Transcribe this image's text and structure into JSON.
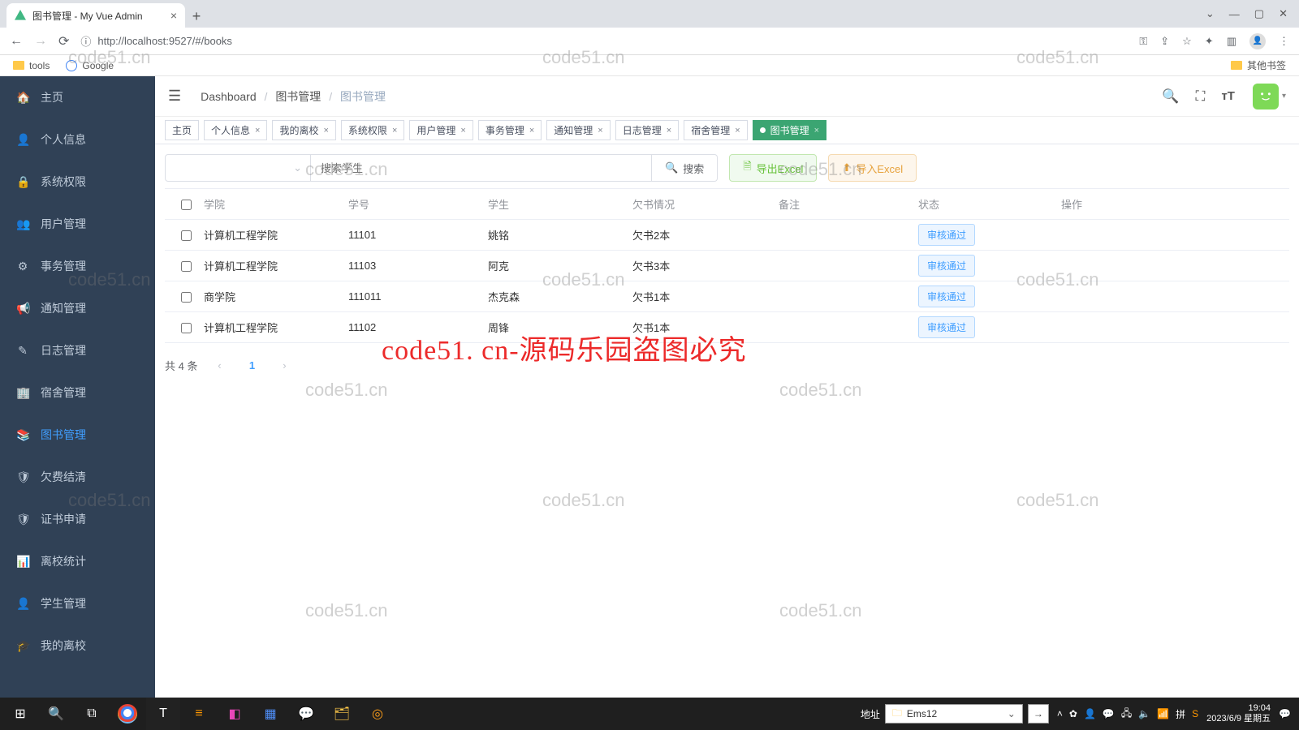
{
  "browser": {
    "tab_title": "图书管理 - My Vue Admin",
    "url": "http://localhost:9527/#/books",
    "bookmarks": {
      "tools": "tools",
      "google": "Google",
      "other": "其他书签"
    }
  },
  "sidebar": {
    "items": [
      {
        "label": "主页"
      },
      {
        "label": "个人信息"
      },
      {
        "label": "系统权限"
      },
      {
        "label": "用户管理"
      },
      {
        "label": "事务管理"
      },
      {
        "label": "通知管理"
      },
      {
        "label": "日志管理"
      },
      {
        "label": "宿舍管理"
      },
      {
        "label": "图书管理"
      },
      {
        "label": "欠费结清"
      },
      {
        "label": "证书申请"
      },
      {
        "label": "离校统计"
      },
      {
        "label": "学生管理"
      },
      {
        "label": "我的离校"
      }
    ],
    "active_index": 8
  },
  "breadcrumb": {
    "a": "Dashboard",
    "b": "图书管理",
    "c": "图书管理"
  },
  "topbar_icons": {
    "search": "search",
    "fullscreen": "fullscreen",
    "textsize": "textsize"
  },
  "tags": [
    {
      "label": "主页",
      "closable": false
    },
    {
      "label": "个人信息",
      "closable": true
    },
    {
      "label": "我的离校",
      "closable": true
    },
    {
      "label": "系统权限",
      "closable": true
    },
    {
      "label": "用户管理",
      "closable": true
    },
    {
      "label": "事务管理",
      "closable": true
    },
    {
      "label": "通知管理",
      "closable": true
    },
    {
      "label": "日志管理",
      "closable": true
    },
    {
      "label": "宿舍管理",
      "closable": true
    },
    {
      "label": "图书管理",
      "closable": true,
      "active": true
    }
  ],
  "toolbar": {
    "select_placeholder": "",
    "search_placeholder": "搜索学生",
    "search_btn": "搜索",
    "export_btn": "导出Excel",
    "import_btn": "导入Excel"
  },
  "table": {
    "headers": {
      "college": "学院",
      "sid": "学号",
      "student": "学生",
      "owe": "欠书情况",
      "note": "备注",
      "status": "状态",
      "op": "操作"
    },
    "rows": [
      {
        "college": "计算机工程学院",
        "sid": "11101",
        "student": "姚铭",
        "owe": "欠书2本",
        "note": "",
        "status_btn": "审核通过"
      },
      {
        "college": "计算机工程学院",
        "sid": "11103",
        "student": "阿克",
        "owe": "欠书3本",
        "note": "",
        "status_btn": "审核通过"
      },
      {
        "college": "商学院",
        "sid": "111011",
        "student": "杰克森",
        "owe": "欠书1本",
        "note": "",
        "status_btn": "审核通过"
      },
      {
        "college": "计算机工程学院",
        "sid": "11102",
        "student": "周锋",
        "owe": "欠书1本",
        "note": "",
        "status_btn": "审核通过"
      }
    ]
  },
  "pagination": {
    "total_text": "共 4 条",
    "current": "1"
  },
  "watermarks": {
    "small": "code51.cn",
    "big": "code51. cn-源码乐园盗图必究"
  },
  "taskbar": {
    "addr_label": "地址",
    "addr_value": "Ems12",
    "time": "19:04",
    "date": "2023/6/9 星期五"
  }
}
